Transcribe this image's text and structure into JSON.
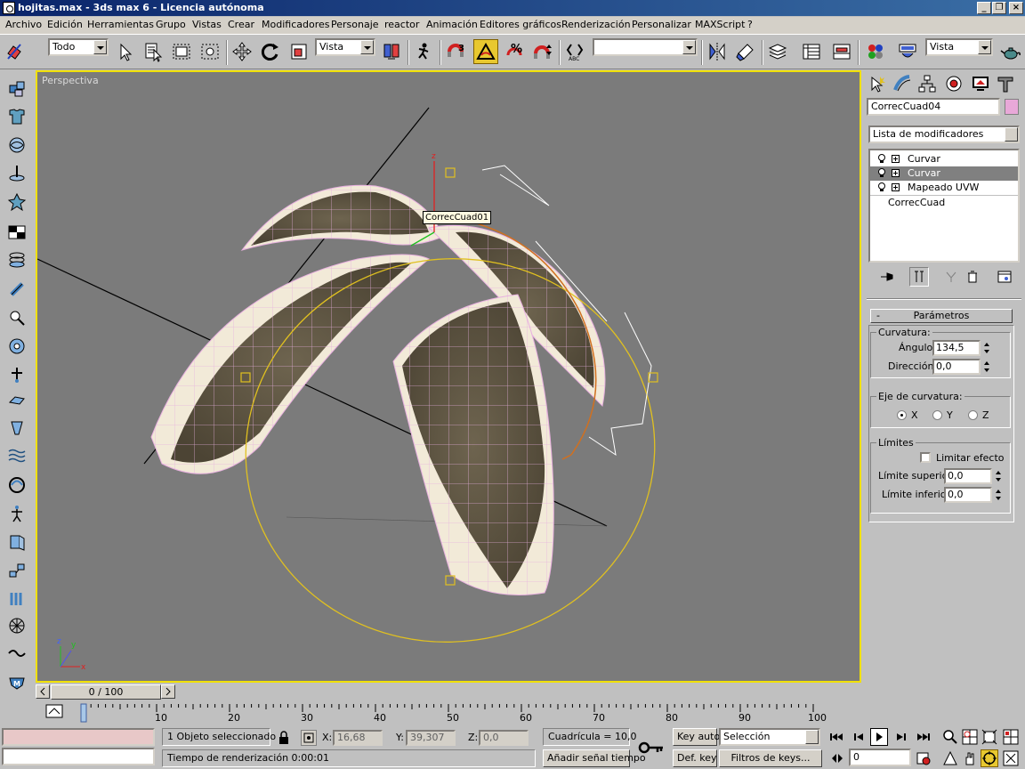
{
  "window": {
    "title": "hojitas.max - 3ds max 6 - Licencia autónoma",
    "minimize": "_",
    "restore": "❐",
    "close": "×"
  },
  "menu": [
    "Archivo",
    "Edición",
    "Herramientas",
    "Grupo",
    "Vistas",
    "Crear",
    "Modificadores",
    "Personaje",
    "reactor",
    "Animación",
    "Editores gráficos",
    "Renderización",
    "Personalizar",
    "MAXScript",
    "?"
  ],
  "toolbar": {
    "selection_filter": "Todo",
    "ref_coord": "Vista",
    "named_selection": "",
    "render_view": "Vista",
    "snap_label": "3",
    "angle_snap_label": "%"
  },
  "viewport": {
    "label": "Perspectiva",
    "tooltip": "CorrecCuad01",
    "axis_labels": {
      "x": "x",
      "y": "y",
      "z": "z"
    }
  },
  "command_panel": {
    "object_name": "CorrecCuad04",
    "object_color": "#e8a8d8",
    "modifier_list_label": "Lista de modificadores",
    "stack": [
      {
        "label": "Curvar",
        "selected": false
      },
      {
        "label": "Curvar",
        "selected": true
      },
      {
        "label": "Mapeado UVW",
        "selected": false
      }
    ],
    "base_object": "CorrecCuad",
    "parameters_title": "Parámetros",
    "rollup_toggle": "-",
    "curvatura": {
      "group_title": "Curvatura:",
      "angle_label": "Ángulo:",
      "angle_value": "134,5",
      "direction_label": "Dirección:",
      "direction_value": "0,0"
    },
    "eje": {
      "group_title": "Eje de curvatura:",
      "options": [
        "X",
        "Y",
        "Z"
      ],
      "selected": "X"
    },
    "limites": {
      "group_title": "Límites",
      "limit_effect_label": "Limitar efecto",
      "upper_label": "Límite superior:",
      "upper_value": "0,0",
      "lower_label": "Límite inferior:",
      "lower_value": "0,0"
    }
  },
  "timeline": {
    "frame_display": "0 / 100",
    "ticks": [
      "0",
      "10",
      "20",
      "30",
      "40",
      "50",
      "60",
      "70",
      "80",
      "90",
      "100"
    ]
  },
  "status": {
    "selection_info": "1 Objeto seleccionado",
    "render_time": "Tiempo de renderización  0:00:01",
    "x_label": "X:",
    "x_value": "16,68",
    "y_label": "Y:",
    "y_value": "39,307",
    "z_label": "Z:",
    "z_value": "0,0",
    "grid": "Cuadrícula = 10,0",
    "add_time_tag": "Añadir señal tiempo",
    "key_auto": "Key auto",
    "set_key": "Def. key",
    "selection_set": "Selección",
    "key_filters": "Filtros de keys...",
    "current_frame": "0"
  },
  "colors": {
    "viewport_bg": "#7b7b7b",
    "active_border": "#f0e000",
    "selection_gizmo": "#e0c020",
    "leaf_edge": "#f0e8d8",
    "leaf_dark": "#5a5140"
  }
}
